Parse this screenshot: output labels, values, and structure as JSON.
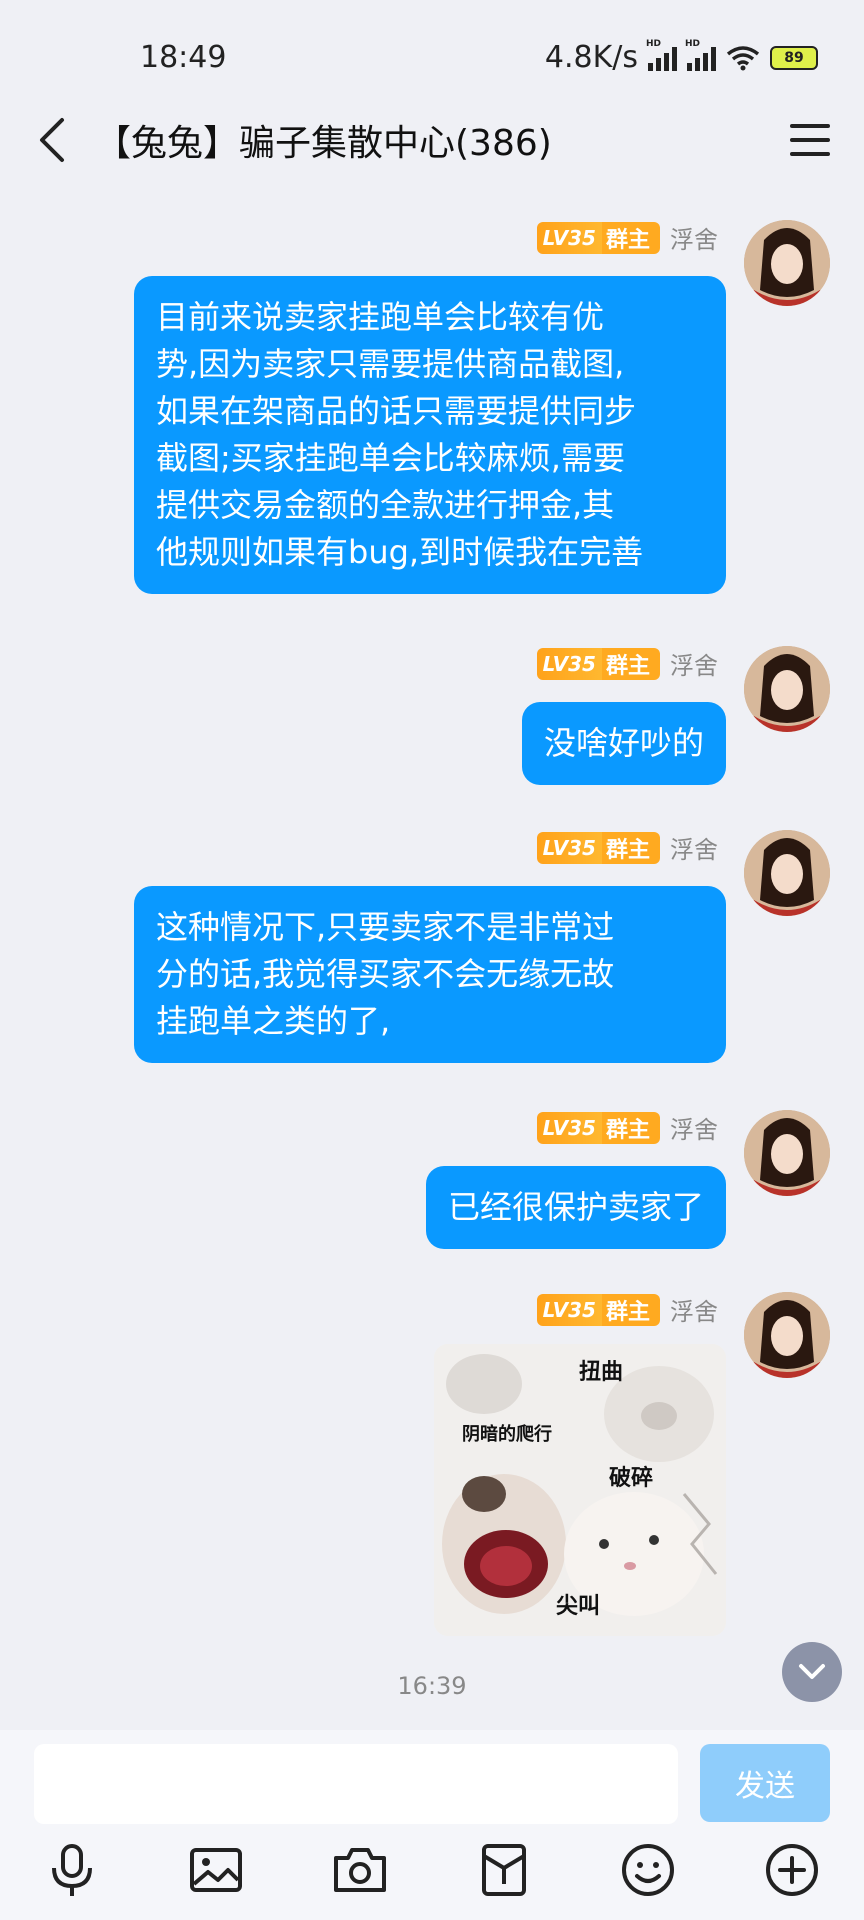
{
  "status": {
    "time": "18:49",
    "speed": "4.8K/s",
    "battery": "89"
  },
  "header": {
    "title": "【兔兔】骗子集散中心(386)"
  },
  "messages": [
    {
      "lv": "LV35",
      "role": "群主",
      "nick": "浮舍",
      "lines": [
        "目前来说卖家挂跑单会比较有优",
        "势,因为卖家只需要提供商品截图,",
        "如果在架商品的话只需要提供同步",
        "截图;买家挂跑单会比较麻烦,需要",
        "提供交易金额的全款进行押金,其",
        "他规则如果有bug,到时候我在完善"
      ]
    },
    {
      "lv": "LV35",
      "role": "群主",
      "nick": "浮舍",
      "lines": [
        "没啥好吵的"
      ]
    },
    {
      "lv": "LV35",
      "role": "群主",
      "nick": "浮舍",
      "lines": [
        "这种情况下,只要卖家不是非常过",
        "分的话,我觉得买家不会无缘无故",
        "挂跑单之类的了,"
      ]
    },
    {
      "lv": "LV35",
      "role": "群主",
      "nick": "浮舍",
      "lines": [
        "已经很保护卖家了"
      ]
    },
    {
      "lv": "LV35",
      "role": "群主",
      "nick": "浮舍",
      "sticker": {
        "labels": [
          "扭曲",
          "阴暗的爬行",
          "破碎",
          "尖叫"
        ]
      }
    }
  ],
  "timestamp": "16:39",
  "input": {
    "value": "",
    "placeholder": ""
  },
  "send_label": "发送",
  "toolbar": [
    "microphone",
    "image",
    "camera",
    "red-packet",
    "emoji",
    "plus"
  ],
  "colors": {
    "bubble": "#0a99ff",
    "send_disabled": "#8fcdfb",
    "lv_tag": "#ffa21a",
    "background": "#eff0f5"
  }
}
